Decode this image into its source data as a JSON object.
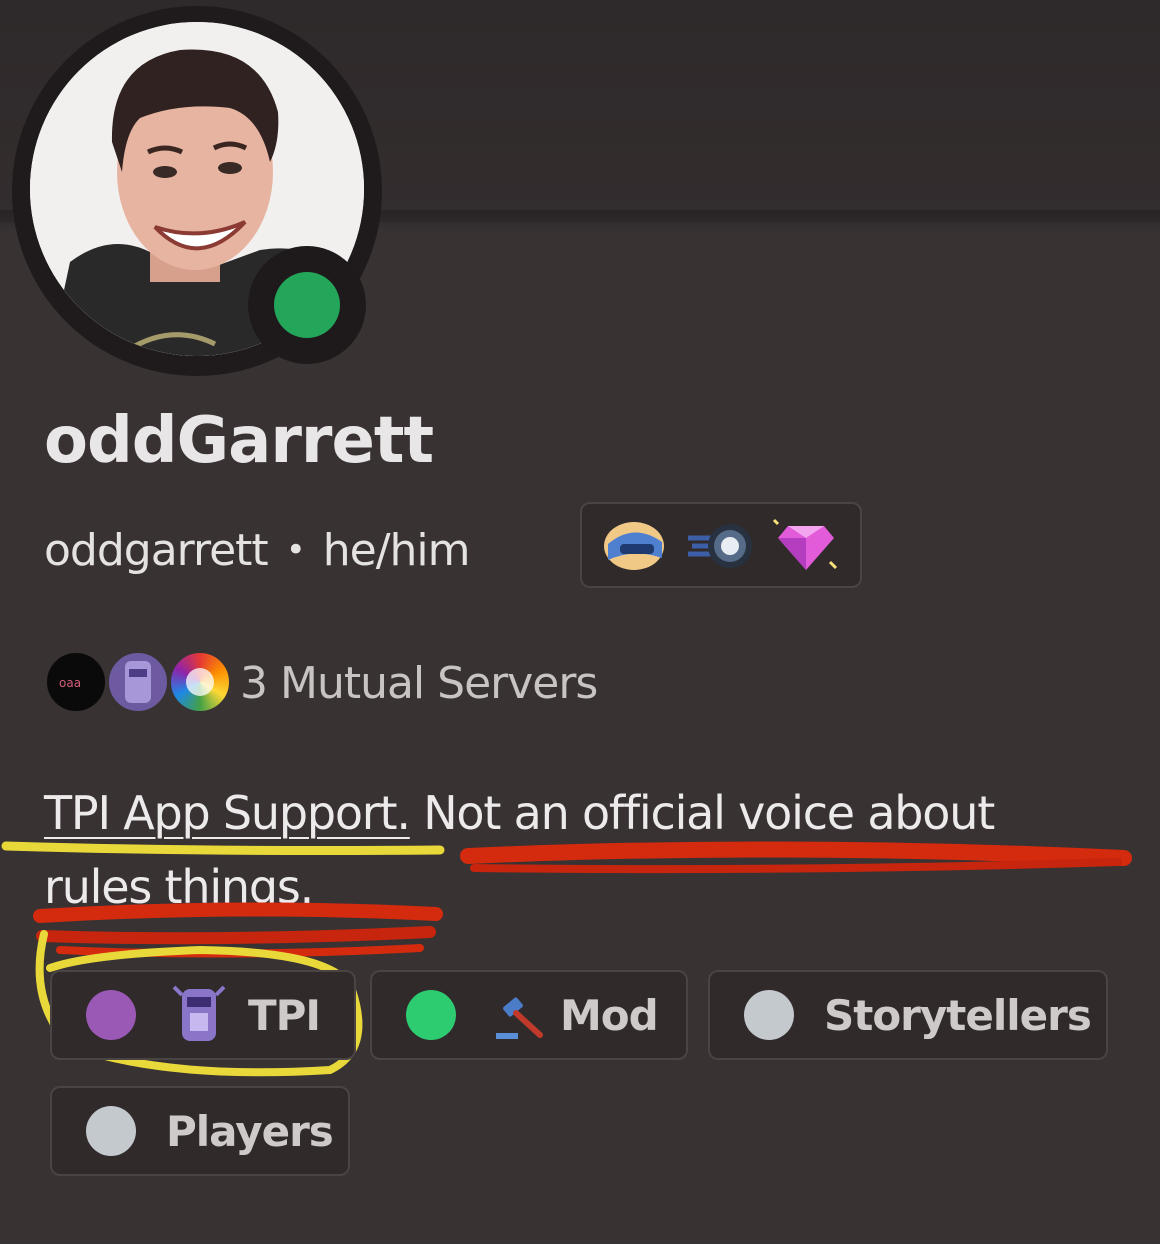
{
  "profile": {
    "display_name": "oddGarrett",
    "username": "oddgarrett",
    "separator": "•",
    "pronouns": "he/him",
    "status": "online",
    "status_color": "#23a55a",
    "badges": [
      "hypesquad-badge-icon",
      "nitro-boost-badge-icon",
      "nitro-gem-badge-icon"
    ]
  },
  "mutual": {
    "label": "3 Mutual Servers",
    "servers": [
      "server-icon-1",
      "server-icon-2",
      "server-icon-3"
    ]
  },
  "bio": {
    "line1_underlined": "TPI App Support.",
    "line1_rest": " Not an official voice about",
    "line2": "rules things."
  },
  "roles": [
    {
      "label": "TPI",
      "color": "#9b59b6",
      "emoji": "tpi-robot-emoji-icon"
    },
    {
      "label": "Mod",
      "color": "#2ecc71",
      "emoji": "gavel-emoji-icon"
    },
    {
      "label": "Storytellers",
      "color": "#c4c9ce"
    },
    {
      "label": "Players",
      "color": "#c4c9ce"
    }
  ]
}
